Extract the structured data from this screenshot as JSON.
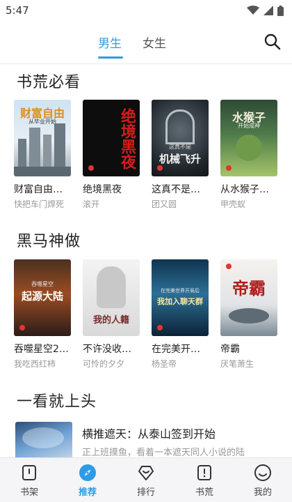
{
  "status_bar": {
    "time": "5:47"
  },
  "header": {
    "tabs": [
      {
        "label": "男生",
        "active": true
      },
      {
        "label": "女生",
        "active": false
      }
    ]
  },
  "sections": [
    {
      "title": "书荒必看",
      "books": [
        {
          "title": "财富自由…",
          "author": "快把车门焊死",
          "cover_text": "财富自由",
          "cover_sub": "从毕业开始"
        },
        {
          "title": "绝境黑夜",
          "author": "滚开",
          "cover_text": "绝境黑夜"
        },
        {
          "title": "这真不是…",
          "author": "团又圆",
          "cover_text": "机械飞升",
          "cover_sub": "这真不是"
        },
        {
          "title": "从水猴子…",
          "author": "甲壳蚁",
          "cover_text": "水猴子",
          "cover_sub": "开始成神"
        }
      ]
    },
    {
      "title": "黑马神做",
      "books": [
        {
          "title": "吞噬星空2…",
          "author": "我吃西红柿",
          "cover_text": "起源大陆",
          "cover_sub": "吞噬星空"
        },
        {
          "title": "不许没收…",
          "author": "可怜的夕夕",
          "cover_text": "我的人籍"
        },
        {
          "title": "在完美开…",
          "author": "杨圣帝",
          "cover_text": "我加入聊天群",
          "cover_sub": "在完美世界开局后"
        },
        {
          "title": "帝霸",
          "author": "厌笔萧生",
          "cover_text": "帝霸"
        }
      ]
    }
  ],
  "feature_section": {
    "title": "一看就上头",
    "item": {
      "title": "横推遮天：从泰山签到开始",
      "description": "正上班摸鱼，看着一本遮天同人小说的陆"
    }
  },
  "bottom_nav": [
    {
      "label": "书架",
      "active": false
    },
    {
      "label": "推荐",
      "active": true
    },
    {
      "label": "排行",
      "active": false
    },
    {
      "label": "书荒",
      "active": false
    },
    {
      "label": "我的",
      "active": false
    }
  ],
  "colors": {
    "accent": "#2f9be6",
    "nav_background": "#f5f5f7"
  }
}
